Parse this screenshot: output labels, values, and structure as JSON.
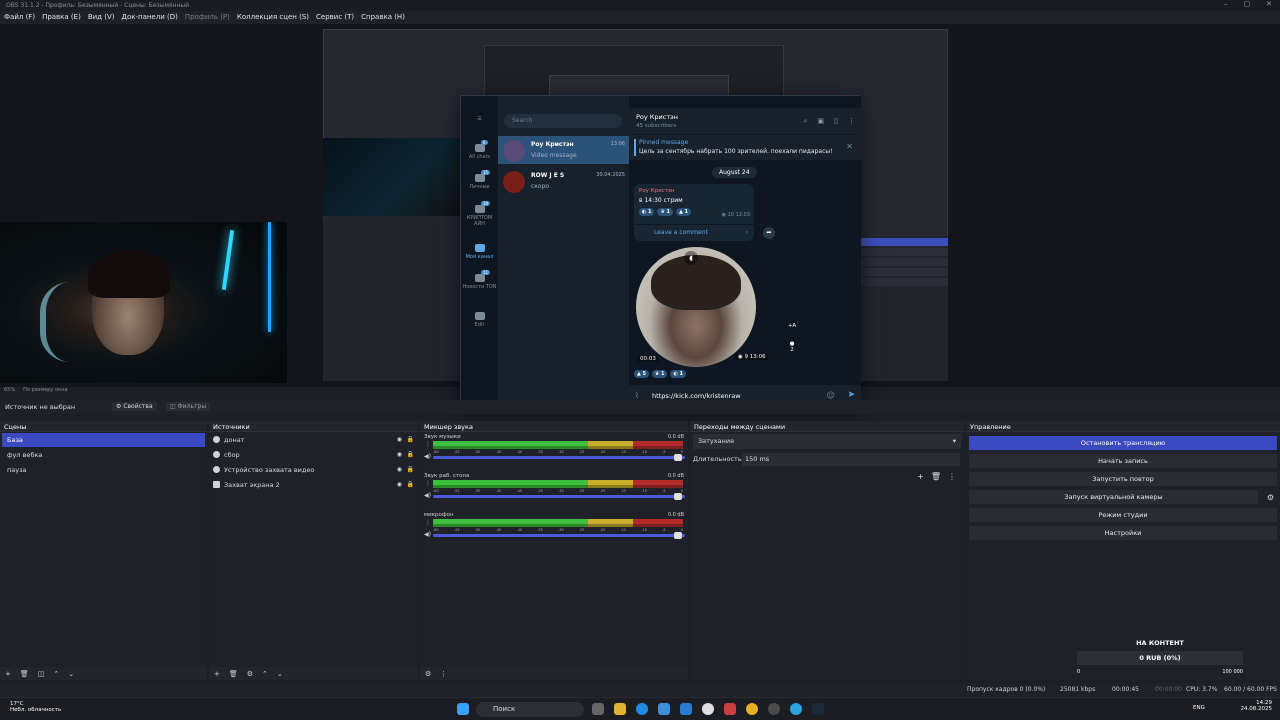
{
  "window": {
    "title": "OBS 31.1.2 - Профиль: Безымянный - Сцены: Безымянный"
  },
  "menu": {
    "items": [
      "Файл (F)",
      "Правка (E)",
      "Вид (V)",
      "Док-панели (D)",
      "Профиль (P)",
      "Коллекция сцен (S)",
      "Сервис (T)",
      "Справка (H)"
    ]
  },
  "preview": {
    "zoom": "65%",
    "scale_mode": "По размеру окна"
  },
  "telegram": {
    "search_placeholder": "Search",
    "folders": [
      {
        "label": "All chats",
        "badge": "6"
      },
      {
        "label": "Личные",
        "badge": "15"
      },
      {
        "label": "КРИПТОМ АЙН",
        "badge": "18"
      },
      {
        "label": "Мой канал",
        "badge": ""
      },
      {
        "label": "Новости TON",
        "badge": "11"
      },
      {
        "label": "Edit",
        "badge": ""
      }
    ],
    "chats": [
      {
        "name": "Роу Кристэн",
        "preview": "Video message",
        "time": "13:06"
      },
      {
        "name": "ROW J E S",
        "preview": "скоро",
        "time": "30.04.2025"
      }
    ],
    "channel_name": "Роу Кристэн",
    "subscribers": "45 subscribers",
    "pinned_label": "Pinned message",
    "pinned_text": "Цель за сентябрь набрать 100 зрителей. поехали пидарасы!",
    "date_chip": "August 24",
    "post_author": "Роу Кристэн",
    "post_text": "в 14:30 стрим",
    "post_reactions": [
      "1",
      "1",
      "1"
    ],
    "post_views": "10",
    "post_time": "12:03",
    "leave_comment": "Leave a comment",
    "video_duration": "00:03",
    "video_views": "9",
    "video_time": "13:06",
    "video_translate": "+A",
    "video_comments": "2",
    "video_reactions": [
      "5",
      "1",
      "1"
    ],
    "input_text": "https://kick.com/kristenraw"
  },
  "source_bar": {
    "no_source": "Источник не выбран",
    "properties": "Свойства",
    "filters": "Фильтры"
  },
  "scenes": {
    "title": "Сцены",
    "items": [
      "База",
      "фул вебка",
      "пауза"
    ]
  },
  "sources": {
    "title": "Источники",
    "items": [
      "донат",
      "сбор",
      "Устройство захвата видео",
      "Захват экрана 2"
    ]
  },
  "mixer": {
    "title": "Микшер звука",
    "channels": [
      {
        "name": "Звук музыки",
        "db": "0.0 dB"
      },
      {
        "name": "Звук раб. стола",
        "db": "0.0 dB"
      },
      {
        "name": "микрофон",
        "db": "0.0 dB"
      }
    ],
    "scale": [
      "-60",
      "-55",
      "-50",
      "-45",
      "-40",
      "-35",
      "-30",
      "-25",
      "-20",
      "-15",
      "-10",
      "-5",
      "0"
    ]
  },
  "transitions": {
    "title": "Переходы между сценами",
    "type": "Затухание",
    "duration_label": "Длительность",
    "duration": "150 ms"
  },
  "controls": {
    "title": "Управление",
    "buttons": [
      "Остановить трансляцию",
      "Начать запись",
      "Запустить повтор",
      "Запуск виртуальной камеры",
      "Режим студии",
      "Настройки"
    ]
  },
  "donation": {
    "title": "НА КОНТЕНТ",
    "amount": "0 RUB (0%)",
    "min": "0",
    "max": "100 000"
  },
  "status": {
    "dropped": "Пропуск кадров 0 (0.0%)",
    "bitrate": "25081 kbps",
    "stream_time": "00:00:45",
    "rec_time": "00:00:00",
    "cpu": "CPU: 3.7%",
    "fps": "60.00 / 60.00 FPS"
  },
  "taskbar": {
    "temp": "17°C",
    "weather": "Небл. облачность",
    "search": "Поиск",
    "lang": "ENG",
    "time": "14:29",
    "date": "24.08.2025"
  }
}
